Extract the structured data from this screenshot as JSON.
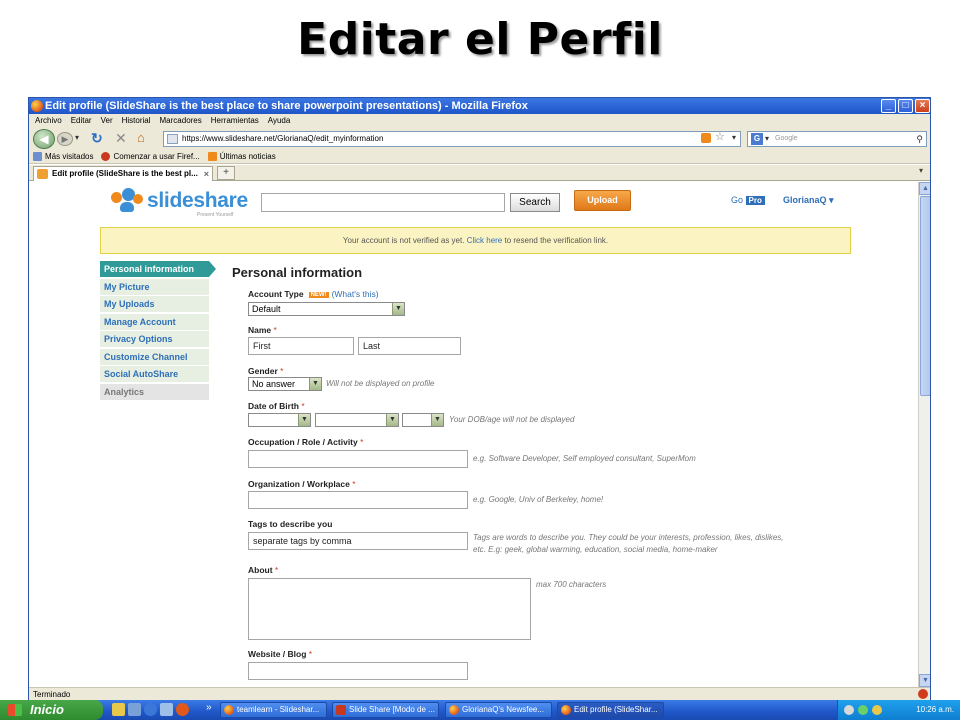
{
  "slide_title": "Editar el Perfil",
  "window": {
    "title": "Edit profile (SlideShare is the best place to share powerpoint presentations) - Mozilla Firefox",
    "controls": [
      "_",
      "□",
      "×"
    ]
  },
  "menu": [
    "Archivo",
    "Editar",
    "Ver",
    "Historial",
    "Marcadores",
    "Herramientas",
    "Ayuda"
  ],
  "nav": {
    "url": "https://www.slideshare.net/GlorianaQ/edit_myinformation",
    "search_placeholder": "Google"
  },
  "bookmarks": [
    "Más visitados",
    "Comenzar a usar Firef...",
    "Últimas noticias"
  ],
  "tab": {
    "label": "Edit profile (SlideShare is the best pl...",
    "new_tab": "+"
  },
  "site": {
    "logo_text": "slideshare",
    "tagline": "Present Yourself",
    "search_button": "Search",
    "upload_button": "Upload",
    "go": "Go",
    "pro": "Pro",
    "user": "GlorianaQ ▾",
    "notice": "Your account is not verified as yet.",
    "notice_link": "Click here",
    "notice_rest": "to resend the verification link."
  },
  "sidebar": [
    {
      "label": "Personal information",
      "state": "active"
    },
    {
      "label": "My Picture"
    },
    {
      "label": "My Uploads"
    },
    {
      "label": "Manage Account"
    },
    {
      "label": "Privacy Options"
    },
    {
      "label": "Customize Channel"
    },
    {
      "label": "Social AutoShare"
    },
    {
      "label": "Analytics",
      "state": "muted"
    }
  ],
  "form": {
    "section_title": "Personal information",
    "account_type": {
      "label": "Account Type",
      "badge": "NEW!",
      "link": "(What's this)",
      "value": "Default"
    },
    "name": {
      "label": "Name",
      "first": "First",
      "last": "Last"
    },
    "gender": {
      "label": "Gender",
      "value": "No answer",
      "hint": "Will not be displayed on profile"
    },
    "dob": {
      "label": "Date of Birth",
      "hint": "Your DOB/age will not be displayed"
    },
    "occupation": {
      "label": "Occupation / Role / Activity",
      "hint": "e.g. Software Developer, Self employed consultant, SuperMom"
    },
    "organization": {
      "label": "Organization / Workplace",
      "hint": "e.g. Google, Univ of Berkeley, home!"
    },
    "tags": {
      "label": "Tags to describe you",
      "placeholder": "separate tags by comma",
      "hint_1": "Tags are words to describe you. They could be your interests, profession, likes, dislikes,",
      "hint_2": "etc. E.g: geek, global warming, education, social media, home-maker"
    },
    "about": {
      "label": "About",
      "hint": "max 700 characters"
    },
    "website": {
      "label": "Website / Blog"
    },
    "required_mark": "*"
  },
  "status": "Terminado",
  "taskbar": {
    "start": "Inicio",
    "overflow": "»",
    "items": [
      "teamlearn - Slideshar...",
      "Slide Share [Modo de ...",
      "GlorianaQ's Newsfee...",
      "Edit profile (SlideShar..."
    ],
    "time": "10:26 a.m."
  },
  "colors": {
    "accent": "#2f6fb8",
    "active_nav": "#2f9a97",
    "upload": "#f08a1c",
    "notice_bg": "#fbf4c2"
  }
}
